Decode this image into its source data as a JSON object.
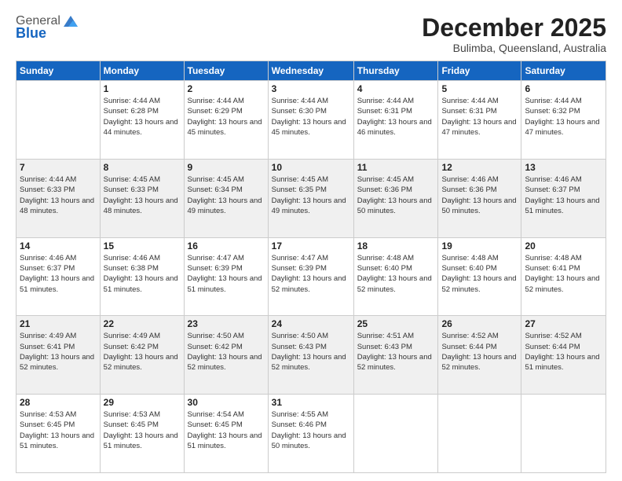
{
  "header": {
    "logo_general": "General",
    "logo_blue": "Blue",
    "month_title": "December 2025",
    "location": "Bulimba, Queensland, Australia"
  },
  "weekdays": [
    "Sunday",
    "Monday",
    "Tuesday",
    "Wednesday",
    "Thursday",
    "Friday",
    "Saturday"
  ],
  "weeks": [
    [
      {
        "day": "",
        "sunrise": "",
        "sunset": "",
        "daylight": ""
      },
      {
        "day": "1",
        "sunrise": "Sunrise: 4:44 AM",
        "sunset": "Sunset: 6:28 PM",
        "daylight": "Daylight: 13 hours and 44 minutes."
      },
      {
        "day": "2",
        "sunrise": "Sunrise: 4:44 AM",
        "sunset": "Sunset: 6:29 PM",
        "daylight": "Daylight: 13 hours and 45 minutes."
      },
      {
        "day": "3",
        "sunrise": "Sunrise: 4:44 AM",
        "sunset": "Sunset: 6:30 PM",
        "daylight": "Daylight: 13 hours and 45 minutes."
      },
      {
        "day": "4",
        "sunrise": "Sunrise: 4:44 AM",
        "sunset": "Sunset: 6:31 PM",
        "daylight": "Daylight: 13 hours and 46 minutes."
      },
      {
        "day": "5",
        "sunrise": "Sunrise: 4:44 AM",
        "sunset": "Sunset: 6:31 PM",
        "daylight": "Daylight: 13 hours and 47 minutes."
      },
      {
        "day": "6",
        "sunrise": "Sunrise: 4:44 AM",
        "sunset": "Sunset: 6:32 PM",
        "daylight": "Daylight: 13 hours and 47 minutes."
      }
    ],
    [
      {
        "day": "7",
        "sunrise": "Sunrise: 4:44 AM",
        "sunset": "Sunset: 6:33 PM",
        "daylight": "Daylight: 13 hours and 48 minutes."
      },
      {
        "day": "8",
        "sunrise": "Sunrise: 4:45 AM",
        "sunset": "Sunset: 6:33 PM",
        "daylight": "Daylight: 13 hours and 48 minutes."
      },
      {
        "day": "9",
        "sunrise": "Sunrise: 4:45 AM",
        "sunset": "Sunset: 6:34 PM",
        "daylight": "Daylight: 13 hours and 49 minutes."
      },
      {
        "day": "10",
        "sunrise": "Sunrise: 4:45 AM",
        "sunset": "Sunset: 6:35 PM",
        "daylight": "Daylight: 13 hours and 49 minutes."
      },
      {
        "day": "11",
        "sunrise": "Sunrise: 4:45 AM",
        "sunset": "Sunset: 6:36 PM",
        "daylight": "Daylight: 13 hours and 50 minutes."
      },
      {
        "day": "12",
        "sunrise": "Sunrise: 4:46 AM",
        "sunset": "Sunset: 6:36 PM",
        "daylight": "Daylight: 13 hours and 50 minutes."
      },
      {
        "day": "13",
        "sunrise": "Sunrise: 4:46 AM",
        "sunset": "Sunset: 6:37 PM",
        "daylight": "Daylight: 13 hours and 51 minutes."
      }
    ],
    [
      {
        "day": "14",
        "sunrise": "Sunrise: 4:46 AM",
        "sunset": "Sunset: 6:37 PM",
        "daylight": "Daylight: 13 hours and 51 minutes."
      },
      {
        "day": "15",
        "sunrise": "Sunrise: 4:46 AM",
        "sunset": "Sunset: 6:38 PM",
        "daylight": "Daylight: 13 hours and 51 minutes."
      },
      {
        "day": "16",
        "sunrise": "Sunrise: 4:47 AM",
        "sunset": "Sunset: 6:39 PM",
        "daylight": "Daylight: 13 hours and 51 minutes."
      },
      {
        "day": "17",
        "sunrise": "Sunrise: 4:47 AM",
        "sunset": "Sunset: 6:39 PM",
        "daylight": "Daylight: 13 hours and 52 minutes."
      },
      {
        "day": "18",
        "sunrise": "Sunrise: 4:48 AM",
        "sunset": "Sunset: 6:40 PM",
        "daylight": "Daylight: 13 hours and 52 minutes."
      },
      {
        "day": "19",
        "sunrise": "Sunrise: 4:48 AM",
        "sunset": "Sunset: 6:40 PM",
        "daylight": "Daylight: 13 hours and 52 minutes."
      },
      {
        "day": "20",
        "sunrise": "Sunrise: 4:48 AM",
        "sunset": "Sunset: 6:41 PM",
        "daylight": "Daylight: 13 hours and 52 minutes."
      }
    ],
    [
      {
        "day": "21",
        "sunrise": "Sunrise: 4:49 AM",
        "sunset": "Sunset: 6:41 PM",
        "daylight": "Daylight: 13 hours and 52 minutes."
      },
      {
        "day": "22",
        "sunrise": "Sunrise: 4:49 AM",
        "sunset": "Sunset: 6:42 PM",
        "daylight": "Daylight: 13 hours and 52 minutes."
      },
      {
        "day": "23",
        "sunrise": "Sunrise: 4:50 AM",
        "sunset": "Sunset: 6:42 PM",
        "daylight": "Daylight: 13 hours and 52 minutes."
      },
      {
        "day": "24",
        "sunrise": "Sunrise: 4:50 AM",
        "sunset": "Sunset: 6:43 PM",
        "daylight": "Daylight: 13 hours and 52 minutes."
      },
      {
        "day": "25",
        "sunrise": "Sunrise: 4:51 AM",
        "sunset": "Sunset: 6:43 PM",
        "daylight": "Daylight: 13 hours and 52 minutes."
      },
      {
        "day": "26",
        "sunrise": "Sunrise: 4:52 AM",
        "sunset": "Sunset: 6:44 PM",
        "daylight": "Daylight: 13 hours and 52 minutes."
      },
      {
        "day": "27",
        "sunrise": "Sunrise: 4:52 AM",
        "sunset": "Sunset: 6:44 PM",
        "daylight": "Daylight: 13 hours and 51 minutes."
      }
    ],
    [
      {
        "day": "28",
        "sunrise": "Sunrise: 4:53 AM",
        "sunset": "Sunset: 6:45 PM",
        "daylight": "Daylight: 13 hours and 51 minutes."
      },
      {
        "day": "29",
        "sunrise": "Sunrise: 4:53 AM",
        "sunset": "Sunset: 6:45 PM",
        "daylight": "Daylight: 13 hours and 51 minutes."
      },
      {
        "day": "30",
        "sunrise": "Sunrise: 4:54 AM",
        "sunset": "Sunset: 6:45 PM",
        "daylight": "Daylight: 13 hours and 51 minutes."
      },
      {
        "day": "31",
        "sunrise": "Sunrise: 4:55 AM",
        "sunset": "Sunset: 6:46 PM",
        "daylight": "Daylight: 13 hours and 50 minutes."
      },
      {
        "day": "",
        "sunrise": "",
        "sunset": "",
        "daylight": ""
      },
      {
        "day": "",
        "sunrise": "",
        "sunset": "",
        "daylight": ""
      },
      {
        "day": "",
        "sunrise": "",
        "sunset": "",
        "daylight": ""
      }
    ]
  ]
}
